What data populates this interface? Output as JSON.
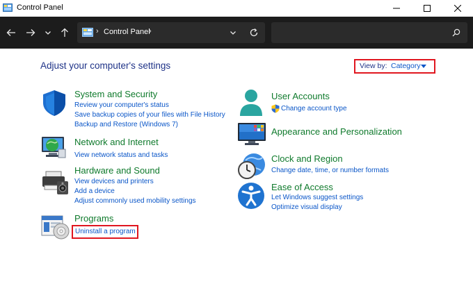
{
  "window": {
    "title": "Control Panel"
  },
  "toolbar": {
    "address": "Control Panel",
    "search_placeholder": ""
  },
  "main": {
    "heading": "Adjust your computer's settings",
    "view_by": {
      "label": "View by:",
      "value": "Category"
    },
    "left_categories": [
      {
        "title": "System and Security",
        "icon": "shield-icon",
        "links": [
          "Review your computer's status",
          "Save backup copies of your files with File History",
          "Backup and Restore (Windows 7)"
        ]
      },
      {
        "title": "Network and Internet",
        "icon": "globe-network-icon",
        "links": [
          "View network status and tasks"
        ]
      },
      {
        "title": "Hardware and Sound",
        "icon": "printer-speaker-icon",
        "links": [
          "View devices and printers",
          "Add a device",
          "Adjust commonly used mobility settings"
        ]
      },
      {
        "title": "Programs",
        "icon": "programs-disc-icon",
        "links": [
          "Uninstall a program"
        ]
      }
    ],
    "right_categories": [
      {
        "title": "User Accounts",
        "icon": "user-icon",
        "links": [
          "Change account type"
        ]
      },
      {
        "title": "Appearance and Personalization",
        "icon": "monitor-icon",
        "links": []
      },
      {
        "title": "Clock and Region",
        "icon": "clock-globe-icon",
        "links": [
          "Change date, time, or number formats"
        ]
      },
      {
        "title": "Ease of Access",
        "icon": "accessibility-icon",
        "links": [
          "Let Windows suggest settings",
          "Optimize visual display"
        ]
      }
    ]
  },
  "colors": {
    "highlight": "#e0161f",
    "category_title": "#0f7a2c",
    "link": "#0a56c8",
    "heading": "#1e3287",
    "toolbar_bg": "#1c1c1c"
  }
}
